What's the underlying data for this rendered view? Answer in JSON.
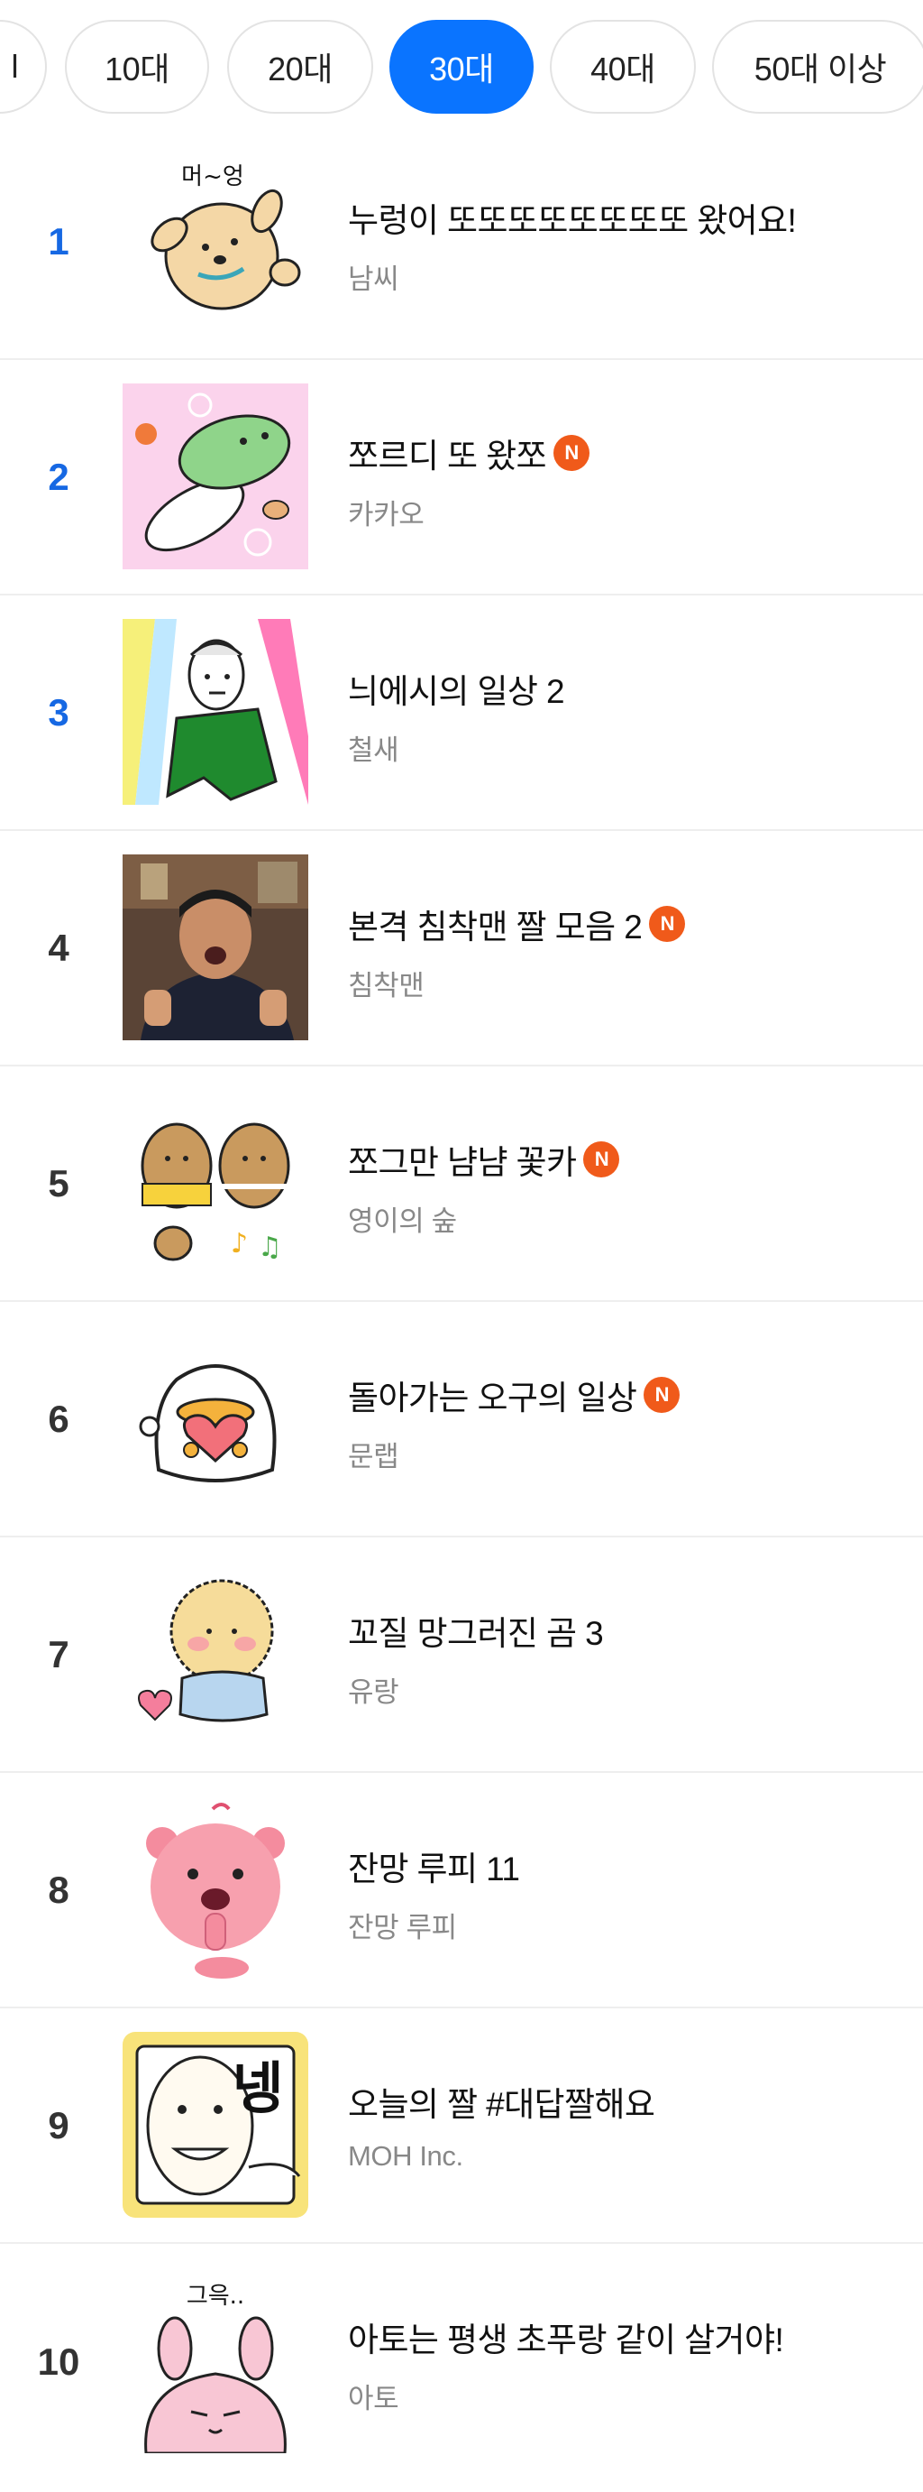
{
  "age_tabs": [
    {
      "label": "l",
      "active": false
    },
    {
      "label": "10대",
      "active": false
    },
    {
      "label": "20대",
      "active": false
    },
    {
      "label": "30대",
      "active": true
    },
    {
      "label": "40대",
      "active": false
    },
    {
      "label": "50대 이상",
      "active": false
    }
  ],
  "colors": {
    "accent": "#0a74ff",
    "rank_top": "#1668e3",
    "new_badge": "#f05a1a"
  },
  "new_badge_text": "N",
  "emoticons": [
    {
      "rank": "1",
      "title": "누렁이 또또또또또또또또 왔어요!",
      "author": "남씨",
      "is_new": false,
      "icon": "dog-sticker-icon",
      "caption": "머~엉"
    },
    {
      "rank": "2",
      "title": "쪼르디 또 왔쪼",
      "author": "카카오",
      "is_new": true,
      "icon": "dinosaur-sticker-icon",
      "caption": ""
    },
    {
      "rank": "3",
      "title": "늬에시의 일상 2",
      "author": "철새",
      "is_new": false,
      "icon": "dancing-man-sticker-icon",
      "caption": ""
    },
    {
      "rank": "4",
      "title": "본격 침착맨 짤 모음 2",
      "author": "침착맨",
      "is_new": true,
      "icon": "thumbs-up-photo-icon",
      "caption": ""
    },
    {
      "rank": "5",
      "title": "쪼그만 냠냠 꽃카",
      "author": "영이의 숲",
      "is_new": true,
      "icon": "quokka-sticker-icon",
      "caption": ""
    },
    {
      "rank": "6",
      "title": "돌아가는 오구의 일상",
      "author": "문랩",
      "is_new": true,
      "icon": "ogu-heart-sticker-icon",
      "caption": ""
    },
    {
      "rank": "7",
      "title": "꼬질 망그러진 곰 3",
      "author": "유랑",
      "is_new": false,
      "icon": "fluffy-bear-sticker-icon",
      "caption": ""
    },
    {
      "rank": "8",
      "title": "잔망 루피 11",
      "author": "잔망 루피",
      "is_new": false,
      "icon": "loopy-beaver-sticker-icon",
      "caption": ""
    },
    {
      "rank": "9",
      "title": "오늘의 짤 #대답짤해요",
      "author": "MOH Inc.",
      "is_new": false,
      "icon": "face-yes-sticker-icon",
      "caption": "넹"
    },
    {
      "rank": "10",
      "title": "아토는 평생 초푸랑 같이 살거야!",
      "author": "아토",
      "is_new": false,
      "icon": "pink-rabbit-sticker-icon",
      "caption": "그윽.."
    }
  ]
}
